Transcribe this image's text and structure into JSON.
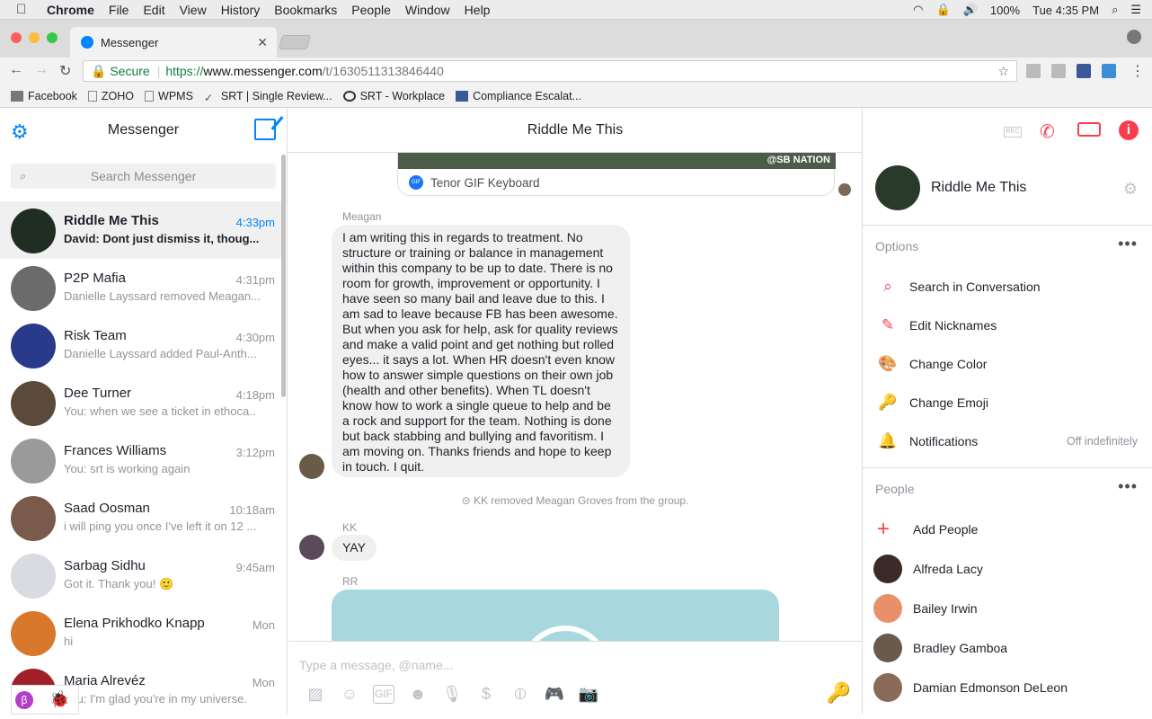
{
  "menubar": {
    "app": "Chrome",
    "items": [
      "File",
      "Edit",
      "View",
      "History",
      "Bookmarks",
      "People",
      "Window",
      "Help"
    ],
    "battery": "100%",
    "clock": "Tue 4:35 PM"
  },
  "browser": {
    "tab_title": "Messenger",
    "secure_label": "Secure",
    "url_proto": "https://",
    "url_domain": "www.messenger.com",
    "url_path": "/t/1630511313846440",
    "bookmarks": [
      "Facebook",
      "ZOHO",
      "WPMS",
      "SRT | Single Review...",
      "SRT - Workplace",
      "Compliance Escalat..."
    ]
  },
  "sidebar": {
    "title": "Messenger",
    "search_placeholder": "Search Messenger",
    "conversations": [
      {
        "name": "Riddle Me This",
        "time": "4:33pm",
        "snippet": "David: Dont just dismiss it, thoug...",
        "active": true,
        "color": "#1f2d22"
      },
      {
        "name": "P2P Mafia",
        "time": "4:31pm",
        "snippet": "Danielle Layssard removed Meagan...",
        "color": "#6b6b6b"
      },
      {
        "name": "Risk Team",
        "time": "4:30pm",
        "snippet": "Danielle Layssard added Paul-Anth...",
        "color": "#2a3a8a"
      },
      {
        "name": "Dee Turner",
        "time": "4:18pm",
        "snippet": "You: when we see a ticket in ethoca..",
        "color": "#5b4a3a"
      },
      {
        "name": "Frances Williams",
        "time": "3:12pm",
        "snippet": "You: srt is working again",
        "color": "#9a9a9a"
      },
      {
        "name": "Saad Oosman",
        "time": "10:18am",
        "snippet": "i will ping you once I've left it on 12 ...",
        "color": "#7a5a4a"
      },
      {
        "name": "Sarbag Sidhu",
        "time": "9:45am",
        "snippet": "Got it. Thank you! 🙂",
        "color": "#d8dbe0"
      },
      {
        "name": "Elena Prikhodko Knapp",
        "time": "Mon",
        "snippet": "hi",
        "color": "#d8782a"
      },
      {
        "name": "Maria Alrevéz",
        "time": "Mon",
        "snippet": "You: I'm glad you're in my universe.",
        "color": "#a0202a"
      }
    ]
  },
  "chat": {
    "title": "Riddle Me This",
    "gif_watermark": "@SB NATION",
    "gif_source": "Tenor GIF Keyboard",
    "messages": [
      {
        "sender": "Meagan",
        "text": "I am writing this in regards to treatment. No structure or training or balance in management within this company to be up to date. There is no room for growth, improvement or opportunity. I have seen so many bail and leave due to this. I am sad to leave because FB has been awesome. But when you ask for help, ask for quality reviews and make a valid point and get nothing but rolled eyes... it says a lot. When HR doesn't even know how to answer simple questions on their own job (health and other benefits). When TL doesn't know how to work a single queue to help and be a rock and support for the team. Nothing is done but back stabbing and bullying and favoritism. I am moving on. Thanks friends and hope to keep in touch. I quit."
      },
      {
        "sender": "KK",
        "text": "YAY"
      }
    ],
    "system_message": "KK removed Meagan Groves from the group.",
    "rr_sender": "RR",
    "composer_placeholder": "Type a message, @name..."
  },
  "details": {
    "name": "Riddle Me This",
    "options_header": "Options",
    "options": [
      {
        "label": "Search in Conversation",
        "icon": "search-icon",
        "glyph": "⌕"
      },
      {
        "label": "Edit Nicknames",
        "icon": "pencil-icon",
        "glyph": "✎"
      },
      {
        "label": "Change Color",
        "icon": "palette-icon",
        "glyph": "🎨"
      },
      {
        "label": "Change Emoji",
        "icon": "key-emoji-icon",
        "glyph": "🔑"
      },
      {
        "label": "Notifications",
        "icon": "bell-icon",
        "glyph": "🔔",
        "value": "Off indefinitely"
      }
    ],
    "people_header": "People",
    "add_people": "Add People",
    "people": [
      {
        "name": "Alfreda Lacy",
        "color": "#3a2a2a"
      },
      {
        "name": "Bailey Irwin",
        "color": "#e8906a"
      },
      {
        "name": "Bradley Gamboa",
        "color": "#6a5a4a"
      },
      {
        "name": "Damian Edmonson DeLeon",
        "color": "#8a6a5a"
      }
    ]
  },
  "colors": {
    "accent": "#0084ff",
    "danger": "#fa3c4c",
    "emoji": "#f7a31c"
  }
}
